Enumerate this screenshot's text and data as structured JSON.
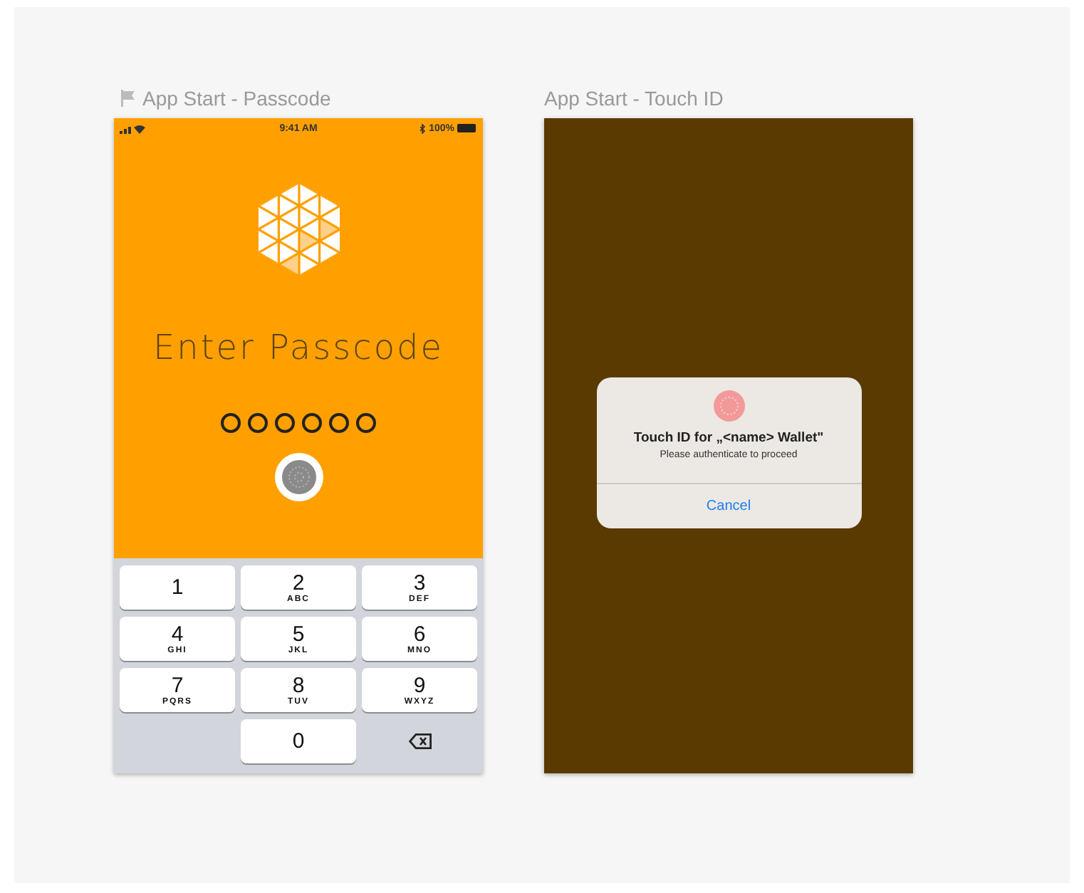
{
  "artboards": [
    {
      "kind": "passcode",
      "title": "App Start - Passcode",
      "flagged": true,
      "status_bar": {
        "time": "9:41 AM",
        "battery": "100%"
      },
      "heading": "Enter Passcode",
      "passcode_dots": [
        {
          "filled": false
        },
        {
          "filled": false
        },
        {
          "filled": false
        },
        {
          "filled": false
        },
        {
          "filled": false
        },
        {
          "filled": false
        }
      ],
      "keys": [
        {
          "kind": "digit",
          "digit": "1"
        },
        {
          "kind": "digit",
          "digit": "2",
          "letters": "ABC"
        },
        {
          "kind": "digit",
          "digit": "3",
          "letters": "DEF"
        },
        {
          "kind": "digit",
          "digit": "4",
          "letters": "GHI"
        },
        {
          "kind": "digit",
          "digit": "5",
          "letters": "JKL"
        },
        {
          "kind": "digit",
          "digit": "6",
          "letters": "MNO"
        },
        {
          "kind": "digit",
          "digit": "7",
          "letters": "PQRS"
        },
        {
          "kind": "digit",
          "digit": "8",
          "letters": "TUV"
        },
        {
          "kind": "digit",
          "digit": "9",
          "letters": "WXYZ"
        },
        {
          "kind": "blank"
        },
        {
          "kind": "digit",
          "digit": "0"
        },
        {
          "kind": "delete"
        }
      ]
    },
    {
      "kind": "touch_id",
      "title": "App Start - Touch ID",
      "flagged": false,
      "dialog": {
        "title": "Touch ID for „<name> Wallet\"",
        "message": "Please authenticate to proceed",
        "button": "Cancel"
      }
    }
  ]
}
